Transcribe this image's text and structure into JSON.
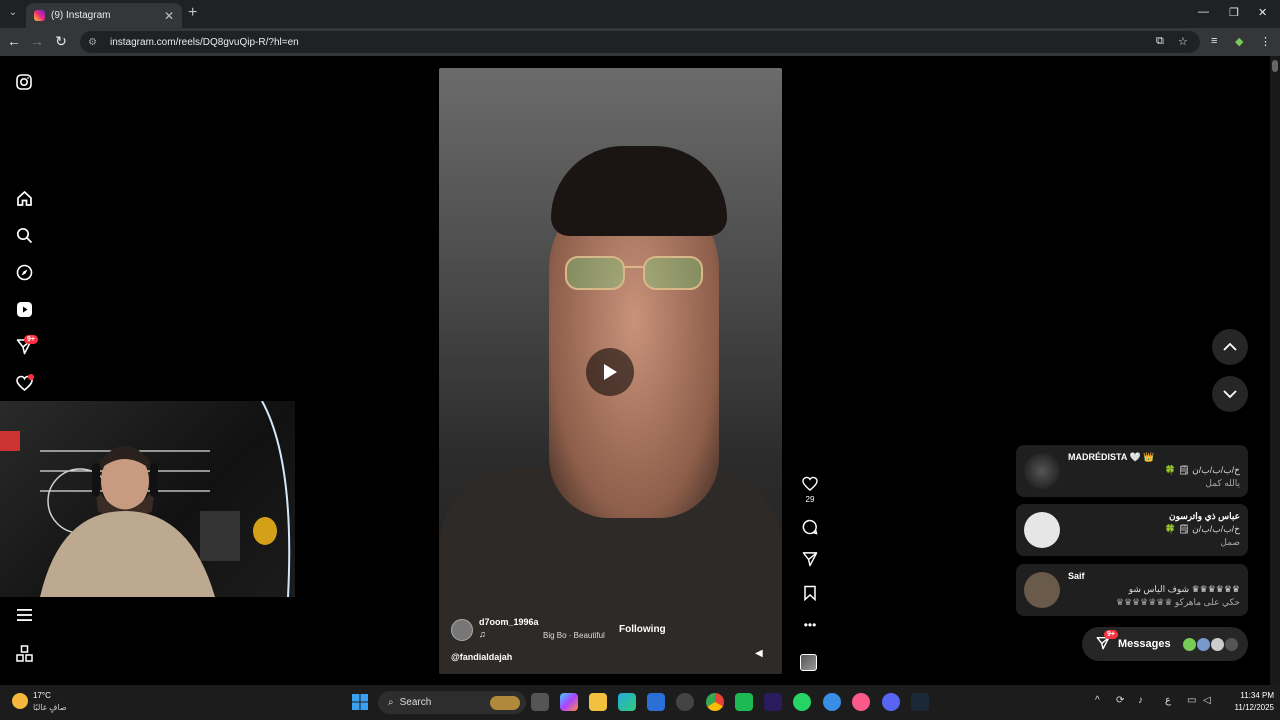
{
  "browser": {
    "tab_title": "(9) Instagram",
    "url": "instagram.com/reels/DQ8gvuQip-R/?hl=en"
  },
  "sidebar": {
    "messages_badge": "9+"
  },
  "reel": {
    "username": "d7oom_1996a",
    "song": "Big Bo · Beautiful",
    "follow_label": "Following",
    "tag": "@fandialdajah",
    "like_count": "29"
  },
  "notifications": [
    {
      "name": "MADRÉDISTA 🤍 👑",
      "line1": "خ/ب/ب/ب/ن 🗒 🍀",
      "line2": "يالله كمل"
    },
    {
      "name": "عباس ذي واترسون",
      "line1": "خ/ب/ب/ب/ن 🗒 🍀",
      "line2": "صمل"
    },
    {
      "name": "Saif",
      "line1": "♛♛♛♛♛♛ شوف الياس شو",
      "line2": "حكي على ماهركو ♛♛♛♛♛♛♛"
    }
  ],
  "messages": {
    "label": "Messages",
    "badge": "9+"
  },
  "taskbar": {
    "weather_temp": "17°C",
    "weather_desc": "صافٍ غالبًا",
    "search_label": "Search",
    "time": "11:34 PM",
    "date": "11/12/2025",
    "lang": "ع"
  }
}
